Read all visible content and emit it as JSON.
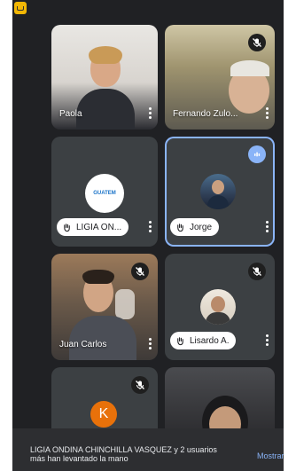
{
  "participants": [
    {
      "name": "Paola",
      "label": "Paola"
    },
    {
      "name": "Fernando Zulo",
      "label": "Fernando Zulo..."
    },
    {
      "name": "LIGIA ONDINA",
      "label": "LIGIA ON..."
    },
    {
      "name": "Jorge",
      "label": "Jorge"
    },
    {
      "name": "Juan Carlos",
      "label": "Juan Carlos"
    },
    {
      "name": "Lisardo A.",
      "label": "Lisardo A."
    },
    {
      "name": "K",
      "label": "K"
    }
  ],
  "org_logo_text": "GUATEM",
  "notification": {
    "text": "LIGIA ONDINA CHINCHILLA VASQUEZ y 2 usuarios más han levantado la mano",
    "action_label": "Mostrar"
  },
  "colors": {
    "tile_bg": "#3c4043",
    "accent": "#8ab4f8",
    "avatar_k": "#e8710a"
  },
  "icons": [
    "mic-off-icon",
    "raised-hand-icon",
    "more-vert-icon",
    "speaking-icon"
  ]
}
